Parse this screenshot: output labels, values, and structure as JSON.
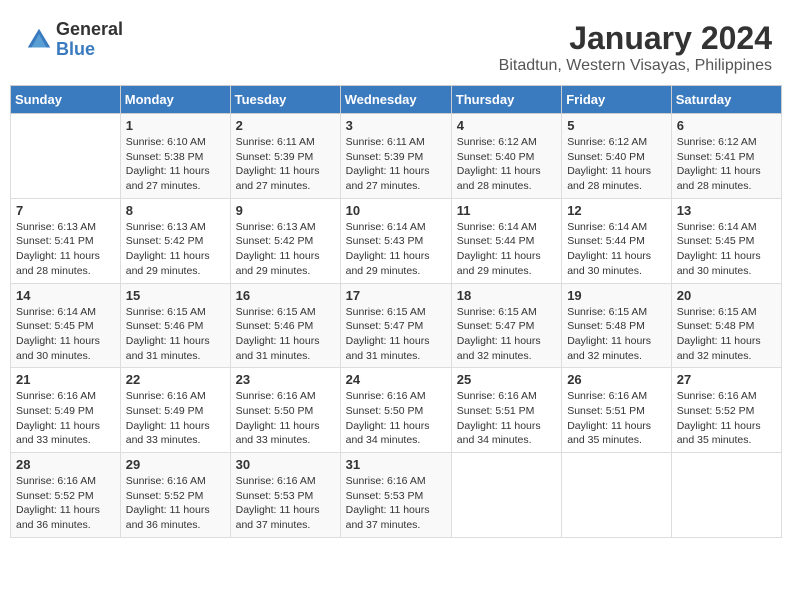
{
  "header": {
    "logo_general": "General",
    "logo_blue": "Blue",
    "title": "January 2024",
    "subtitle": "Bitadtun, Western Visayas, Philippines"
  },
  "calendar": {
    "days_of_week": [
      "Sunday",
      "Monday",
      "Tuesday",
      "Wednesday",
      "Thursday",
      "Friday",
      "Saturday"
    ],
    "weeks": [
      [
        {
          "day": "",
          "sunrise": "",
          "sunset": "",
          "daylight": ""
        },
        {
          "day": "1",
          "sunrise": "Sunrise: 6:10 AM",
          "sunset": "Sunset: 5:38 PM",
          "daylight": "Daylight: 11 hours and 27 minutes."
        },
        {
          "day": "2",
          "sunrise": "Sunrise: 6:11 AM",
          "sunset": "Sunset: 5:39 PM",
          "daylight": "Daylight: 11 hours and 27 minutes."
        },
        {
          "day": "3",
          "sunrise": "Sunrise: 6:11 AM",
          "sunset": "Sunset: 5:39 PM",
          "daylight": "Daylight: 11 hours and 27 minutes."
        },
        {
          "day": "4",
          "sunrise": "Sunrise: 6:12 AM",
          "sunset": "Sunset: 5:40 PM",
          "daylight": "Daylight: 11 hours and 28 minutes."
        },
        {
          "day": "5",
          "sunrise": "Sunrise: 6:12 AM",
          "sunset": "Sunset: 5:40 PM",
          "daylight": "Daylight: 11 hours and 28 minutes."
        },
        {
          "day": "6",
          "sunrise": "Sunrise: 6:12 AM",
          "sunset": "Sunset: 5:41 PM",
          "daylight": "Daylight: 11 hours and 28 minutes."
        }
      ],
      [
        {
          "day": "7",
          "sunrise": "Sunrise: 6:13 AM",
          "sunset": "Sunset: 5:41 PM",
          "daylight": "Daylight: 11 hours and 28 minutes."
        },
        {
          "day": "8",
          "sunrise": "Sunrise: 6:13 AM",
          "sunset": "Sunset: 5:42 PM",
          "daylight": "Daylight: 11 hours and 29 minutes."
        },
        {
          "day": "9",
          "sunrise": "Sunrise: 6:13 AM",
          "sunset": "Sunset: 5:42 PM",
          "daylight": "Daylight: 11 hours and 29 minutes."
        },
        {
          "day": "10",
          "sunrise": "Sunrise: 6:14 AM",
          "sunset": "Sunset: 5:43 PM",
          "daylight": "Daylight: 11 hours and 29 minutes."
        },
        {
          "day": "11",
          "sunrise": "Sunrise: 6:14 AM",
          "sunset": "Sunset: 5:44 PM",
          "daylight": "Daylight: 11 hours and 29 minutes."
        },
        {
          "day": "12",
          "sunrise": "Sunrise: 6:14 AM",
          "sunset": "Sunset: 5:44 PM",
          "daylight": "Daylight: 11 hours and 30 minutes."
        },
        {
          "day": "13",
          "sunrise": "Sunrise: 6:14 AM",
          "sunset": "Sunset: 5:45 PM",
          "daylight": "Daylight: 11 hours and 30 minutes."
        }
      ],
      [
        {
          "day": "14",
          "sunrise": "Sunrise: 6:14 AM",
          "sunset": "Sunset: 5:45 PM",
          "daylight": "Daylight: 11 hours and 30 minutes."
        },
        {
          "day": "15",
          "sunrise": "Sunrise: 6:15 AM",
          "sunset": "Sunset: 5:46 PM",
          "daylight": "Daylight: 11 hours and 31 minutes."
        },
        {
          "day": "16",
          "sunrise": "Sunrise: 6:15 AM",
          "sunset": "Sunset: 5:46 PM",
          "daylight": "Daylight: 11 hours and 31 minutes."
        },
        {
          "day": "17",
          "sunrise": "Sunrise: 6:15 AM",
          "sunset": "Sunset: 5:47 PM",
          "daylight": "Daylight: 11 hours and 31 minutes."
        },
        {
          "day": "18",
          "sunrise": "Sunrise: 6:15 AM",
          "sunset": "Sunset: 5:47 PM",
          "daylight": "Daylight: 11 hours and 32 minutes."
        },
        {
          "day": "19",
          "sunrise": "Sunrise: 6:15 AM",
          "sunset": "Sunset: 5:48 PM",
          "daylight": "Daylight: 11 hours and 32 minutes."
        },
        {
          "day": "20",
          "sunrise": "Sunrise: 6:15 AM",
          "sunset": "Sunset: 5:48 PM",
          "daylight": "Daylight: 11 hours and 32 minutes."
        }
      ],
      [
        {
          "day": "21",
          "sunrise": "Sunrise: 6:16 AM",
          "sunset": "Sunset: 5:49 PM",
          "daylight": "Daylight: 11 hours and 33 minutes."
        },
        {
          "day": "22",
          "sunrise": "Sunrise: 6:16 AM",
          "sunset": "Sunset: 5:49 PM",
          "daylight": "Daylight: 11 hours and 33 minutes."
        },
        {
          "day": "23",
          "sunrise": "Sunrise: 6:16 AM",
          "sunset": "Sunset: 5:50 PM",
          "daylight": "Daylight: 11 hours and 33 minutes."
        },
        {
          "day": "24",
          "sunrise": "Sunrise: 6:16 AM",
          "sunset": "Sunset: 5:50 PM",
          "daylight": "Daylight: 11 hours and 34 minutes."
        },
        {
          "day": "25",
          "sunrise": "Sunrise: 6:16 AM",
          "sunset": "Sunset: 5:51 PM",
          "daylight": "Daylight: 11 hours and 34 minutes."
        },
        {
          "day": "26",
          "sunrise": "Sunrise: 6:16 AM",
          "sunset": "Sunset: 5:51 PM",
          "daylight": "Daylight: 11 hours and 35 minutes."
        },
        {
          "day": "27",
          "sunrise": "Sunrise: 6:16 AM",
          "sunset": "Sunset: 5:52 PM",
          "daylight": "Daylight: 11 hours and 35 minutes."
        }
      ],
      [
        {
          "day": "28",
          "sunrise": "Sunrise: 6:16 AM",
          "sunset": "Sunset: 5:52 PM",
          "daylight": "Daylight: 11 hours and 36 minutes."
        },
        {
          "day": "29",
          "sunrise": "Sunrise: 6:16 AM",
          "sunset": "Sunset: 5:52 PM",
          "daylight": "Daylight: 11 hours and 36 minutes."
        },
        {
          "day": "30",
          "sunrise": "Sunrise: 6:16 AM",
          "sunset": "Sunset: 5:53 PM",
          "daylight": "Daylight: 11 hours and 37 minutes."
        },
        {
          "day": "31",
          "sunrise": "Sunrise: 6:16 AM",
          "sunset": "Sunset: 5:53 PM",
          "daylight": "Daylight: 11 hours and 37 minutes."
        },
        {
          "day": "",
          "sunrise": "",
          "sunset": "",
          "daylight": ""
        },
        {
          "day": "",
          "sunrise": "",
          "sunset": "",
          "daylight": ""
        },
        {
          "day": "",
          "sunrise": "",
          "sunset": "",
          "daylight": ""
        }
      ]
    ]
  }
}
